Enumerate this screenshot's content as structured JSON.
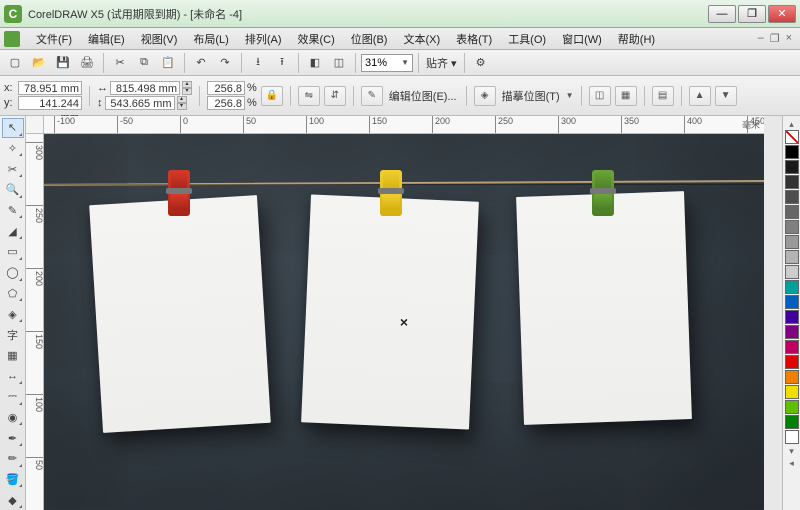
{
  "window": {
    "title": "CorelDRAW X5 (试用期限到期) - [未命名 -4]",
    "app_initial": "C",
    "min": "—",
    "max": "❐",
    "close": "✕"
  },
  "mdi": {
    "min": "–",
    "restore": "❐",
    "close": "×"
  },
  "menu": {
    "file": "文件(F)",
    "edit": "编辑(E)",
    "view": "视图(V)",
    "layout": "布局(L)",
    "arrange": "排列(A)",
    "effects": "效果(C)",
    "bitmaps": "位图(B)",
    "text": "文本(X)",
    "table": "表格(T)",
    "tools": "工具(O)",
    "window": "窗口(W)",
    "help": "帮助(H)"
  },
  "toolbar": {
    "zoom_value": "31%",
    "snap_label": "贴齐 ▾"
  },
  "propbar": {
    "x_label": "x:",
    "y_label": "y:",
    "x_value": "78.951 mm",
    "y_value": "141.244 mm",
    "w_value": "815.498 mm",
    "h_value": "543.665 mm",
    "pct1": "256.8",
    "pct2": "256.8",
    "pct_unit": "%",
    "edit_bitmap": "编辑位图(E)...",
    "trace_bitmap": "描摹位图(T)"
  },
  "ruler": {
    "unit": "毫米",
    "h_ticks": [
      "-100",
      "-50",
      "0",
      "50",
      "100",
      "150",
      "200",
      "250",
      "300",
      "350",
      "400",
      "450"
    ],
    "v_ticks": [
      "300",
      "250",
      "200",
      "150",
      "100",
      "50"
    ]
  },
  "palette_colors": [
    "#000000",
    "#1a1a1a",
    "#333333",
    "#4d4d4d",
    "#666666",
    "#808080",
    "#999999",
    "#b3b3b3",
    "#cccccc",
    "#00a0a0",
    "#0060c0",
    "#4000a0",
    "#800080",
    "#c00060",
    "#e00000",
    "#f08000",
    "#f0e000",
    "#60c000",
    "#008000",
    "#ffffff"
  ]
}
